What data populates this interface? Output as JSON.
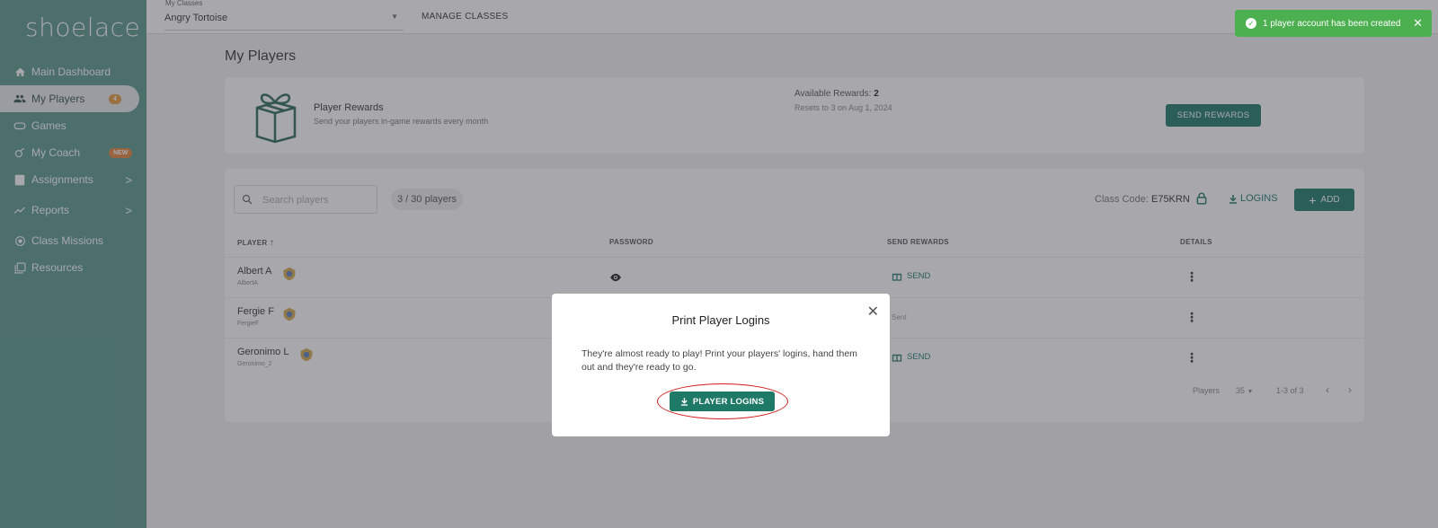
{
  "brand": {
    "logo": "shoelace",
    "accent": "#1e7a66",
    "sidebar_bg": "#5a9a8b"
  },
  "sidebar": {
    "items": [
      {
        "label": "Main Dashboard",
        "icon": "home-icon"
      },
      {
        "label": "My Players",
        "icon": "people-icon",
        "badge": "4",
        "active": true
      },
      {
        "label": "Games",
        "icon": "gamepad-icon"
      },
      {
        "label": "My Coach",
        "icon": "coach-icon",
        "badge": "NEW"
      },
      {
        "label": "Assignments",
        "icon": "clipboard-icon",
        "chevron": ">"
      },
      {
        "label": "Reports",
        "icon": "trending-icon",
        "chevron": ">"
      },
      {
        "label": "Class Missions",
        "icon": "target-icon"
      },
      {
        "label": "Resources",
        "icon": "library-icon"
      }
    ]
  },
  "topbar": {
    "class_label": "My Classes",
    "class_value": "Angry Tortoise",
    "manage": "MANAGE CLASSES"
  },
  "main": {
    "title": "My Players",
    "rewards": {
      "title": "Player Rewards",
      "subtitle": "Send your players in-game rewards every month",
      "available_label": "Available Rewards:",
      "available_value": "2",
      "resets": "Resets to 3 on Aug 1, 2024",
      "button": "SEND REWARDS"
    },
    "players": {
      "search_placeholder": "Search players",
      "count": "3 / 30 players",
      "class_code_label": "Class Code:",
      "class_code": "E75KRN",
      "logins": "LOGINS",
      "add": "ADD",
      "headers": {
        "player": "PLAYER",
        "password": "PASSWORD",
        "send_rewards": "SEND REWARDS",
        "details": "DETAILS"
      },
      "rows": [
        {
          "name": "Albert A",
          "username": "AlbertA",
          "reward": "SEND"
        },
        {
          "name": "Fergie F",
          "username": "FergieF",
          "reward": "Sent"
        },
        {
          "name": "Geronimo L",
          "username": "Geronimo_2",
          "reward": "SEND"
        }
      ],
      "pager": {
        "label": "Players",
        "per_page": "35",
        "range": "1-3 of 3"
      }
    }
  },
  "toast": {
    "message": "1 player account has been created",
    "color": "#4caf50"
  },
  "modal": {
    "title": "Print Player Logins",
    "body": "They're almost ready to play! Print your players' logins, hand them out and they're ready to go.",
    "button": "PLAYER LOGINS"
  }
}
